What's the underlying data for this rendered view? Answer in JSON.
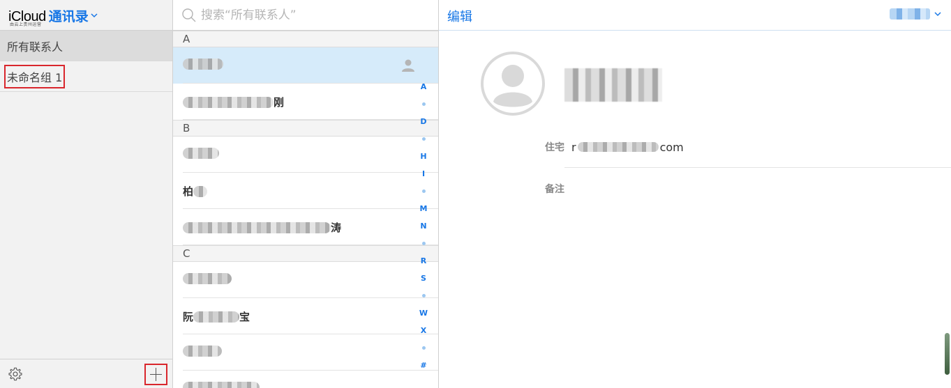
{
  "sidebar": {
    "brand": {
      "icloud": "iCloud",
      "app_name": "通讯录",
      "subtitle": "由云上贵州运营"
    },
    "groups": [
      {
        "label": "所有联系人"
      },
      {
        "label": "未命名组 1"
      }
    ]
  },
  "search": {
    "placeholder": "搜索“所有联系人”"
  },
  "list": {
    "sections": [
      {
        "letter": "A"
      },
      {
        "letter": "B"
      },
      {
        "letter": "C"
      }
    ],
    "visible_name_fragments": [
      "刚",
      "柏",
      "涛",
      "阮",
      "宝"
    ],
    "index": [
      "A",
      "D",
      "H",
      "I",
      "M",
      "N",
      "R",
      "S",
      "W",
      "X",
      "#"
    ]
  },
  "detail": {
    "edit_label": "编辑",
    "email_prefix": "r",
    "email_suffix": "com",
    "fields": {
      "home_label": "住宅",
      "notes_label": "备注"
    }
  },
  "colors": {
    "accent": "#1877e6",
    "selected_row": "#d6ebfa",
    "highlight_box": "#d9262c"
  }
}
